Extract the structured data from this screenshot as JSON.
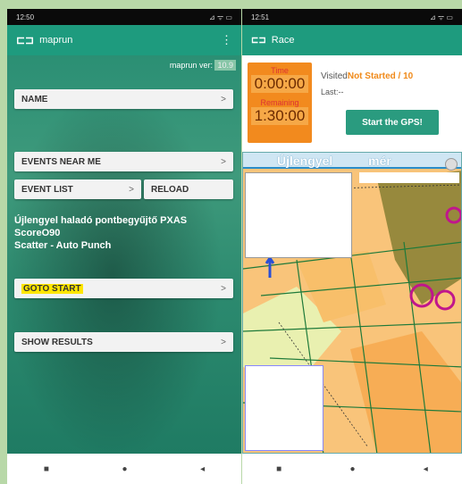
{
  "left": {
    "status": {
      "time": "12:50",
      "icons": "⊿ ᯤ ▭"
    },
    "appbar": {
      "icon": "⊏⊐",
      "title": "maprun",
      "menu": "⋮"
    },
    "version": {
      "label": "maprun ver:",
      "value": "10.9"
    },
    "buttons": {
      "name": "NAME",
      "events_near": "EVENTS NEAR ME",
      "event_list": "EVENT LIST",
      "reload": "RELOAD",
      "goto_start": "GOTO START",
      "show_results": "SHOW RESULTS"
    },
    "chevron": ">",
    "event_title": [
      "Újlengyel haladó pontbegyűjtő PXAS ScoreO90",
      "Scatter - Auto Punch"
    ]
  },
  "right": {
    "status": {
      "time": "12:51",
      "icons": "⊿ ᯤ ▭"
    },
    "appbar": {
      "icon": "⊏⊐",
      "title": "Race"
    },
    "timer": {
      "time_label": "Time",
      "time_value": "0:00:00",
      "remaining_label": "Remaining",
      "remaining_value": "1:30:00"
    },
    "visited_label": "Visited",
    "visited_status": "Not Started / 10",
    "last": "Last:--",
    "gps_button": "Start the GPS!",
    "map": {
      "title_left": "Újlengyel",
      "title_right": "mér"
    }
  },
  "nav": {
    "square": "■",
    "circle": "●",
    "back": "◂"
  }
}
